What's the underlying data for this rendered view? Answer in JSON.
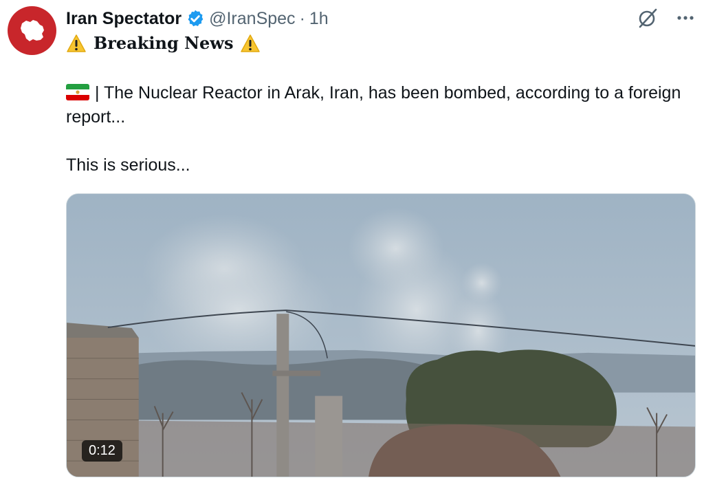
{
  "author": {
    "display_name": "Iran Spectator",
    "handle": "@IranSpec",
    "separator": "·",
    "time": "1h",
    "verified": true,
    "avatar_color": "#c8262b"
  },
  "icons": {
    "verified": "verified-badge-icon",
    "grok": "grok-icon",
    "more": "more-options-icon",
    "warning": "warning-icon",
    "flag": "iran-flag-icon"
  },
  "tweet": {
    "headline": "Breaking News",
    "line1": "| The Nuclear Reactor in Arak, Iran, has been bombed, according to a foreign report...",
    "line2": "This is serious..."
  },
  "media": {
    "type": "video",
    "duration": "0:12"
  },
  "colors": {
    "verified_blue": "#1d9bf0",
    "secondary_text": "#536471",
    "warning_yellow": "#f7c531"
  }
}
